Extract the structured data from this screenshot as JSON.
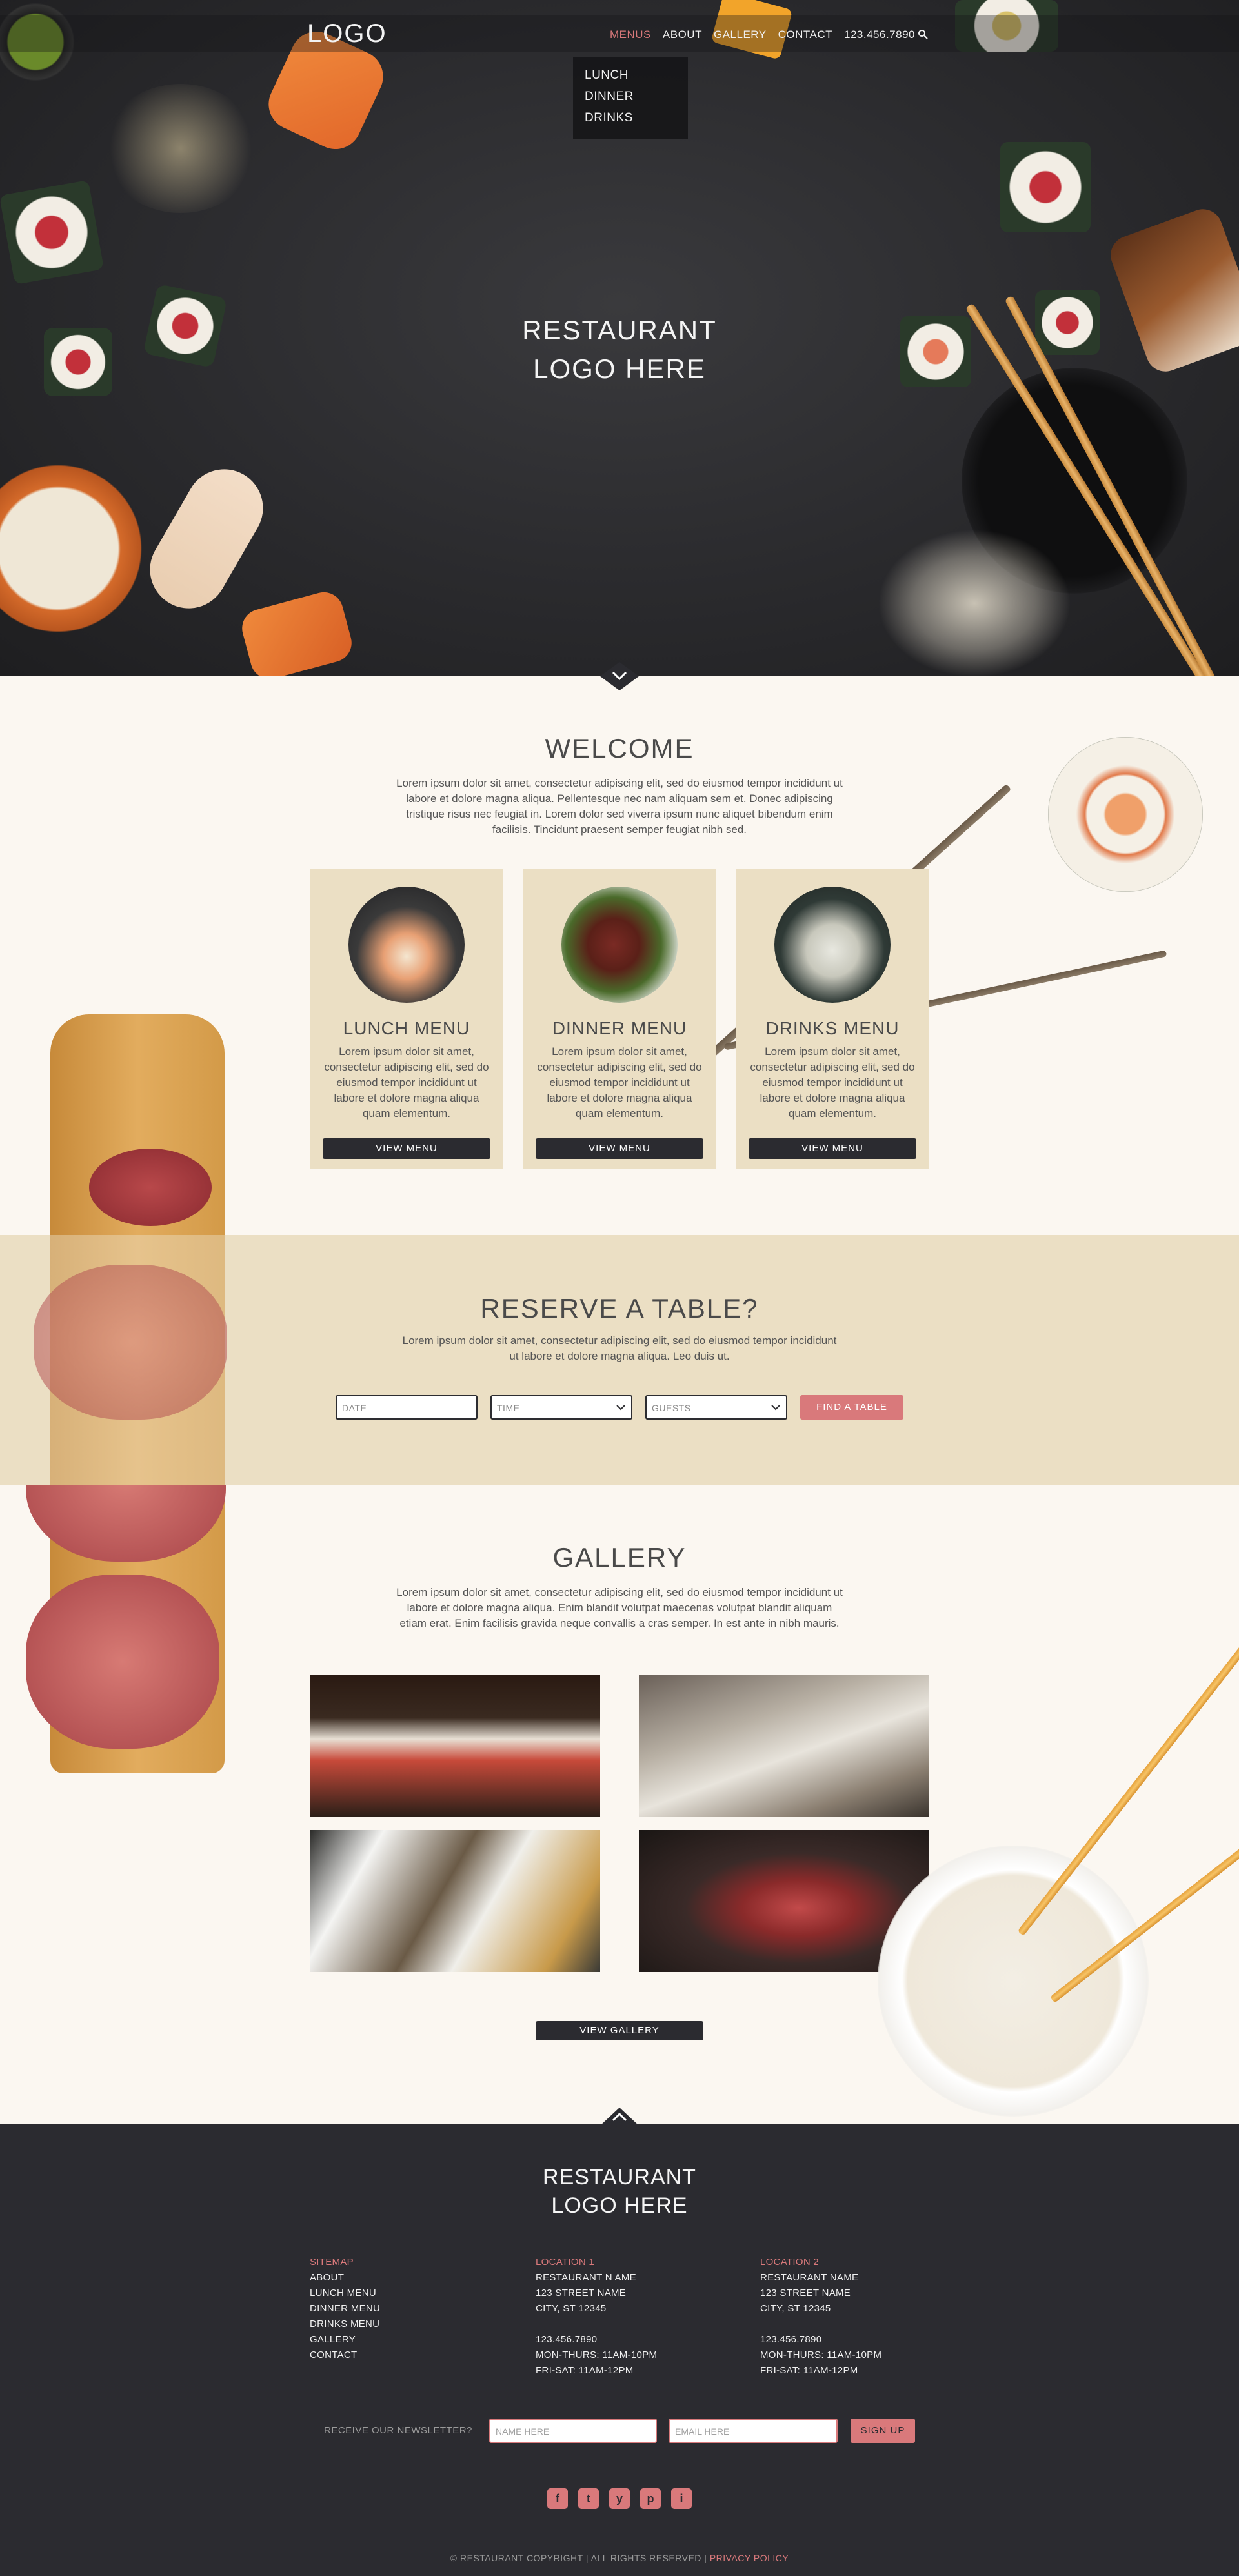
{
  "nav": {
    "logo": "LOGO",
    "items": [
      "MENUS",
      "ABOUT",
      "GALLERY",
      "CONTACT",
      "123.456.7890"
    ],
    "dropdown": [
      "LUNCH",
      "DINNER",
      "DRINKS"
    ]
  },
  "hero": {
    "title_line1": "RESTAURANT",
    "title_line2": "LOGO HERE"
  },
  "welcome": {
    "title": "WELCOME",
    "text": "Lorem ipsum dolor sit amet, consectetur adipiscing elit, sed do eiusmod tempor incididunt ut labore et dolore magna aliqua. Pellentesque nec nam aliquam sem et. Donec adipiscing tristique risus nec feugiat in. Lorem dolor sed viverra ipsum nunc aliquet bibendum enim facilisis. Tincidunt praesent semper feugiat nibh sed."
  },
  "cards": [
    {
      "title": "LUNCH MENU",
      "text": "Lorem ipsum dolor sit amet, consectetur adipiscing elit, sed do eiusmod tempor incididunt ut labore et dolore magna aliqua quam elementum.",
      "button": "VIEW MENU"
    },
    {
      "title": "DINNER MENU",
      "text": "Lorem ipsum dolor sit amet, consectetur adipiscing elit, sed do eiusmod tempor incididunt ut labore et dolore magna aliqua quam elementum.",
      "button": "VIEW MENU"
    },
    {
      "title": "DRINKS MENU",
      "text": "Lorem ipsum dolor sit amet, consectetur adipiscing elit, sed do eiusmod tempor incididunt ut labore et dolore magna aliqua quam elementum.",
      "button": "VIEW MENU"
    }
  ],
  "reserve": {
    "title": "RESERVE A TABLE?",
    "text": "Lorem ipsum dolor sit amet, consectetur adipiscing elit, sed do eiusmod tempor incididunt ut labore et dolore magna aliqua. Leo duis ut.",
    "date_placeholder": "DATE",
    "time_placeholder": "TIME",
    "guests_placeholder": "GUESTS",
    "button": "FIND A TABLE"
  },
  "gallery": {
    "title": "GALLERY",
    "text": "Lorem ipsum dolor sit amet, consectetur adipiscing elit, sed do eiusmod tempor incididunt ut labore et dolore magna aliqua. Enim blandit volutpat maecenas volutpat blandit aliquam etiam erat. Enim facilisis gravida neque convallis a cras semper. In est ante in nibh mauris.",
    "button": "VIEW GALLERY"
  },
  "footer": {
    "logo_line1": "RESTAURANT",
    "logo_line2": "LOGO HERE",
    "sitemap": {
      "heading": "SITEMAP",
      "links": [
        "ABOUT",
        "LUNCH MENU",
        "DINNER MENU",
        "DRINKS MENU",
        "GALLERY",
        "CONTACT"
      ]
    },
    "location1": {
      "heading": "LOCATION 1",
      "lines": [
        "RESTAURANT N AME",
        "123 STREET NAME",
        "CITY, ST 12345",
        "",
        "123.456.7890",
        "MON-THURS: 11AM-10PM",
        "FRI-SAT: 11AM-12PM"
      ]
    },
    "location2": {
      "heading": "LOCATION 2",
      "lines": [
        "RESTAURANT NAME",
        "123 STREET NAME",
        "CITY, ST 12345",
        "",
        "123.456.7890",
        "MON-THURS: 11AM-10PM",
        "FRI-SAT: 11AM-12PM"
      ]
    },
    "newsletter_label": "RECEIVE OUR NEWSLETTER?",
    "name_placeholder": "NAME HERE",
    "email_placeholder": "EMAIL HERE",
    "signup": "SIGN UP",
    "social": [
      "f",
      "t",
      "y",
      "p",
      "i"
    ],
    "copyright": "© RESTAURANT COPYRIGHT | ALL RIGHTS RESERVED |",
    "privacy": "PRIVACY POLICY"
  },
  "colors": {
    "accent": "#d9797b",
    "dark": "#2b2b30",
    "beige": "#ebdfc4",
    "cream": "#fbf7f1"
  }
}
